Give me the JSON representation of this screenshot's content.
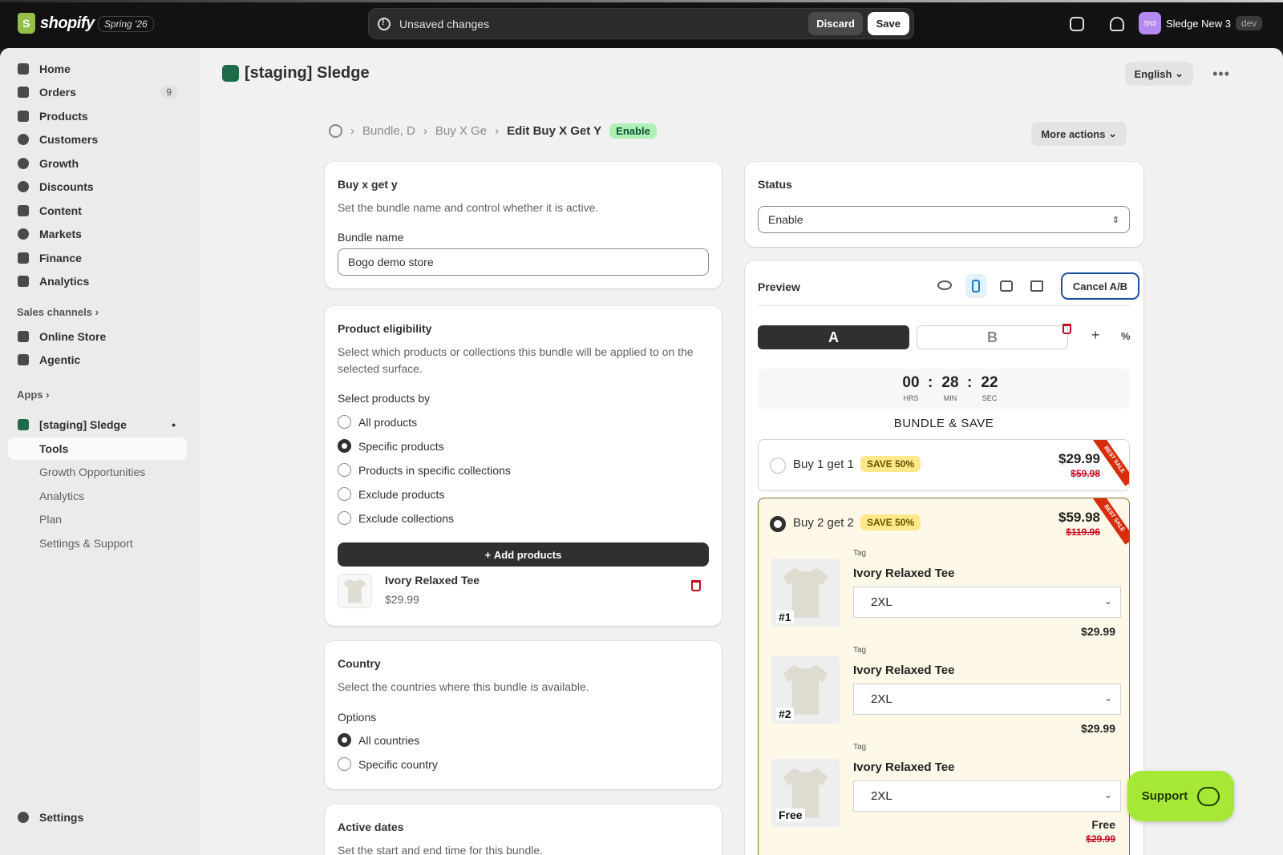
{
  "topbar": {
    "logo_text": "shopify",
    "version_badge": "Spring '26",
    "unsaved_text": "Unsaved changes",
    "discard_label": "Discard",
    "save_label": "Save",
    "account_initials": "SN3",
    "account_name": "Sledge New 3",
    "account_badge": "dev"
  },
  "sidebar": {
    "items": [
      {
        "label": "Home",
        "icon": "home-icon"
      },
      {
        "label": "Orders",
        "icon": "orders-icon",
        "badge": "9"
      },
      {
        "label": "Products",
        "icon": "tag-icon"
      },
      {
        "label": "Customers",
        "icon": "person-icon"
      },
      {
        "label": "Growth",
        "icon": "gauge-icon"
      },
      {
        "label": "Discounts",
        "icon": "discount-icon"
      },
      {
        "label": "Content",
        "icon": "content-icon"
      },
      {
        "label": "Markets",
        "icon": "globe-icon"
      },
      {
        "label": "Finance",
        "icon": "bank-icon"
      },
      {
        "label": "Analytics",
        "icon": "bar-chart-icon"
      }
    ],
    "sales_channels_label": "Sales channels",
    "channels": [
      {
        "label": "Online Store",
        "icon": "store-icon"
      },
      {
        "label": "Agentic",
        "icon": "agentic-icon"
      }
    ],
    "apps_label": "Apps",
    "app_name": "[staging] Sledge",
    "app_subitems": [
      "Tools",
      "Growth Opportunities",
      "Analytics",
      "Plan",
      "Settings & Support"
    ],
    "settings_label": "Settings"
  },
  "header": {
    "app_title": "[staging] Sledge",
    "language": "English",
    "breadcrumb": [
      "Bundle, D",
      "Buy X Ge",
      "Edit Buy X Get Y"
    ],
    "status_badge": "Enable",
    "more_actions": "More actions"
  },
  "bundle_card": {
    "title": "Buy x get y",
    "description": "Set the bundle name and control whether it is active.",
    "name_label": "Bundle name",
    "name_value": "Bogo demo store"
  },
  "eligibility_card": {
    "title": "Product eligibility",
    "description": "Select which products or collections this bundle will be applied to on the selected surface.",
    "select_by_label": "Select products by",
    "options": [
      "All products",
      "Specific products",
      "Products in specific collections",
      "Exclude products",
      "Exclude collections"
    ],
    "selected_option": "Specific products",
    "add_button": "Add products",
    "product": {
      "name": "Ivory Relaxed Tee",
      "price": "$29.99"
    }
  },
  "country_card": {
    "title": "Country",
    "description": "Select the countries where this bundle is available.",
    "options_label": "Options",
    "options": [
      "All countries",
      "Specific country"
    ],
    "selected_option": "All countries"
  },
  "dates_card": {
    "title": "Active dates",
    "description": "Set the start and end time for this bundle."
  },
  "status_card": {
    "title": "Status",
    "value": "Enable"
  },
  "preview_card": {
    "title": "Preview",
    "cancel_ab": "Cancel A/B",
    "variant_a": "A",
    "variant_b": "B",
    "timer": {
      "hours": "00",
      "minutes": "28",
      "seconds": "22",
      "hours_label": "HRS",
      "minutes_label": "MIN",
      "seconds_label": "SEC"
    },
    "headline": "BUNDLE & SAVE",
    "ribbon_text": "BEST SALE",
    "tiers": [
      {
        "name": "Buy 1 get 1",
        "save": "SAVE 50%",
        "price": "$29.99",
        "compare": "$59.98",
        "selected": false
      },
      {
        "name": "Buy 2 get 2",
        "save": "SAVE 50%",
        "price": "$59.98",
        "compare": "$119.96",
        "selected": true
      }
    ],
    "items": [
      {
        "number": "#1",
        "tag": "Tag",
        "name": "Ivory Relaxed Tee",
        "size": "2XL",
        "price": "$29.99",
        "compare": ""
      },
      {
        "number": "#2",
        "tag": "Tag",
        "name": "Ivory Relaxed Tee",
        "size": "2XL",
        "price": "$29.99",
        "compare": ""
      },
      {
        "number": "Free",
        "tag": "Tag",
        "name": "Ivory Relaxed Tee",
        "size": "2XL",
        "price": "Free",
        "compare": "$29.99"
      }
    ]
  },
  "support_label": "Support",
  "colors": {
    "accent": "#303030",
    "support": "#a6e835",
    "status_badge": "#aff0b5",
    "save_badge": "#fde88a",
    "ribbon": "#d82c0d"
  }
}
